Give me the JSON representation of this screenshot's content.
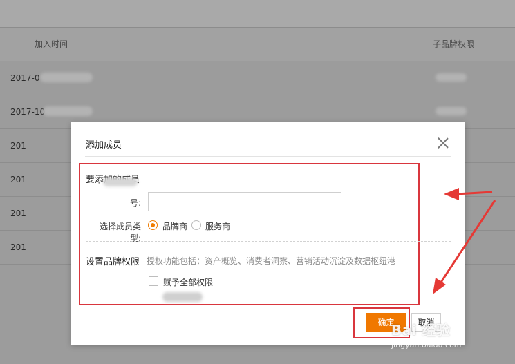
{
  "background": {
    "columns": {
      "join_time": "加入时间",
      "sub_brand_permission": "子品牌权限"
    },
    "rows": [
      {
        "time": "2017-0"
      },
      {
        "time": "2017-10"
      },
      {
        "time": "201"
      },
      {
        "time": "201"
      },
      {
        "time": "201"
      },
      {
        "time": "201"
      }
    ]
  },
  "dialog": {
    "title": "添加成员",
    "section_member": {
      "title": "要添加的成员",
      "account_label": "号:",
      "account_value": "",
      "type_label": "选择成员类型:",
      "types": [
        {
          "label": "品牌商",
          "checked": true
        },
        {
          "label": "服务商",
          "checked": false
        }
      ]
    },
    "section_permission": {
      "title": "设置品牌权限",
      "hint": "授权功能包括：资产概览、消费者洞察、营销活动沉淀及数据枢纽港",
      "options": [
        {
          "label": "赋予全部权限",
          "checked": false
        },
        {
          "label": "",
          "checked": false
        }
      ]
    },
    "buttons": {
      "confirm": "确定",
      "cancel": "取消"
    }
  },
  "watermark": {
    "logo": "Bai 经验",
    "url": "jingyan.baidu.com"
  },
  "colors": {
    "accent": "#f07800",
    "annotation_red": "#d9363e"
  }
}
